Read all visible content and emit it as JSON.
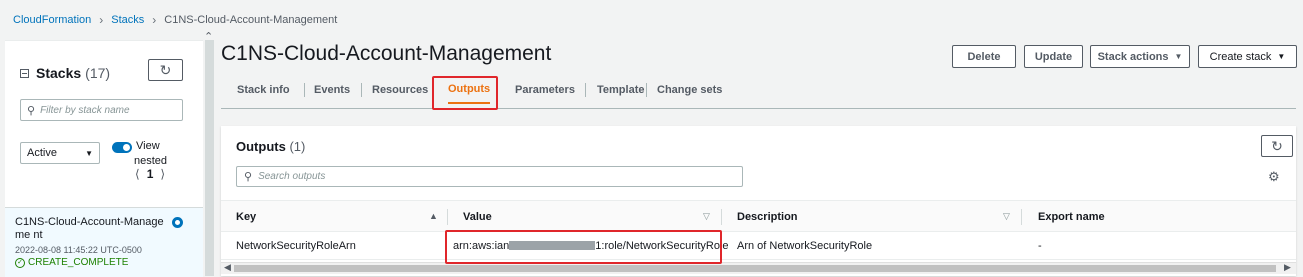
{
  "breadcrumb": {
    "items": [
      "CloudFormation",
      "Stacks"
    ],
    "current": "C1NS-Cloud-Account-Management"
  },
  "sidebar": {
    "title": "Stacks",
    "count": "(17)",
    "filter_placeholder": "Filter by stack name",
    "status_filter": "Active",
    "view_label": "View",
    "nested_label": "nested",
    "page": "1",
    "stack": {
      "name": "C1NS-Cloud-Account-Manageme nt",
      "date": "2022-08-08 11:45:22 UTC-0500",
      "status": "CREATE_COMPLETE"
    }
  },
  "header": {
    "title": "C1NS-Cloud-Account-Management",
    "delete_label": "Delete",
    "update_label": "Update",
    "stack_actions_label": "Stack actions",
    "create_stack_label": "Create stack"
  },
  "tabs": [
    "Stack info",
    "Events",
    "Resources",
    "Outputs",
    "Parameters",
    "Template",
    "Change sets"
  ],
  "active_tab": "Outputs",
  "outputs": {
    "title": "Outputs",
    "count": "(1)",
    "search_placeholder": "Search outputs",
    "columns": [
      "Key",
      "Value",
      "Description",
      "Export name"
    ],
    "rows": [
      {
        "key": "NetworkSecurityRoleArn",
        "value_prefix": "arn:aws:ian",
        "value_suffix": "1:role/NetworkSecurityRole",
        "description": "Arn of NetworkSecurityRole",
        "export_name": "-"
      }
    ]
  },
  "colors": {
    "link": "#0073bb",
    "active_tab": "#ec7211",
    "highlight": "#e0262b",
    "success": "#1d8102"
  }
}
